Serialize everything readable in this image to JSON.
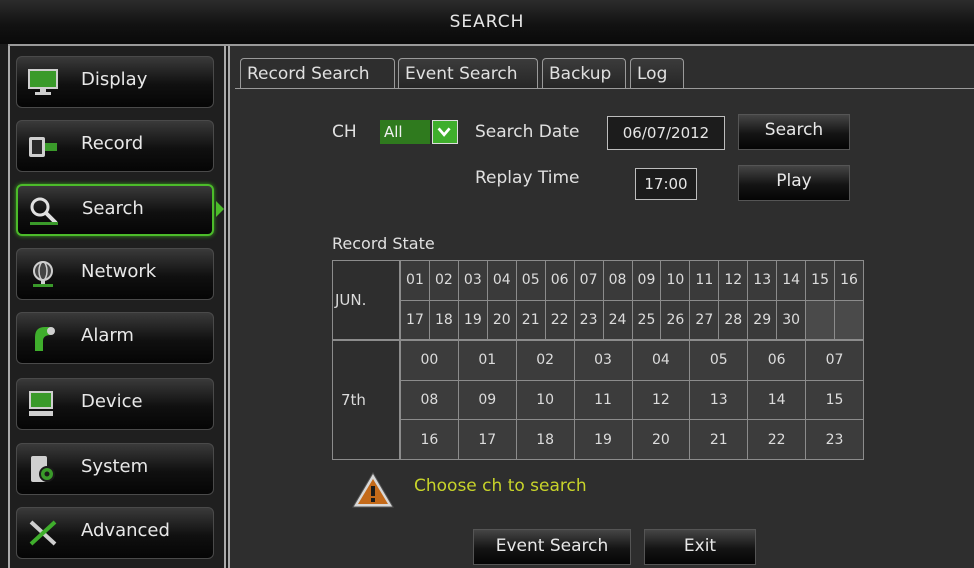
{
  "window": {
    "title": "SEARCH"
  },
  "sidebar": {
    "items": [
      {
        "label": "Display",
        "icon": "monitor-icon"
      },
      {
        "label": "Record",
        "icon": "camera-icon"
      },
      {
        "label": "Search",
        "icon": "magnifier-icon",
        "active": true
      },
      {
        "label": "Network",
        "icon": "globe-icon"
      },
      {
        "label": "Alarm",
        "icon": "alarm-icon"
      },
      {
        "label": "Device",
        "icon": "computer-icon"
      },
      {
        "label": "System",
        "icon": "system-icon"
      },
      {
        "label": "Advanced",
        "icon": "tools-icon"
      }
    ]
  },
  "tabs": [
    {
      "label": "Record Search",
      "active": true
    },
    {
      "label": "Event Search"
    },
    {
      "label": "Backup"
    },
    {
      "label": "Log"
    }
  ],
  "form": {
    "ch_label": "CH",
    "ch_value": "All",
    "search_date_label": "Search Date",
    "search_date_value": "06/07/2012",
    "search_button": "Search",
    "replay_time_label": "Replay Time",
    "replay_time_value": "17:00",
    "play_button": "Play"
  },
  "record_state": {
    "label": "Record State",
    "month_label": "JUN.",
    "days_row1": [
      "01",
      "02",
      "03",
      "04",
      "05",
      "06",
      "07",
      "08",
      "09",
      "10",
      "11",
      "12",
      "13",
      "14",
      "15",
      "16"
    ],
    "days_row2": [
      "17",
      "18",
      "19",
      "20",
      "21",
      "22",
      "23",
      "24",
      "25",
      "26",
      "27",
      "28",
      "29",
      "30",
      "",
      ""
    ],
    "day_label": "7th",
    "hours": [
      [
        "00",
        "01",
        "02",
        "03",
        "04",
        "05",
        "06",
        "07"
      ],
      [
        "08",
        "09",
        "10",
        "11",
        "12",
        "13",
        "14",
        "15"
      ],
      [
        "16",
        "17",
        "18",
        "19",
        "20",
        "21",
        "22",
        "23"
      ]
    ]
  },
  "warning": {
    "text": "Choose ch to search",
    "icon": "warning-icon"
  },
  "footer": {
    "event_search_button": "Event Search",
    "exit_button": "Exit"
  },
  "colors": {
    "accent_green": "#4cbc2a",
    "warning_yellow": "#c8d42a"
  }
}
